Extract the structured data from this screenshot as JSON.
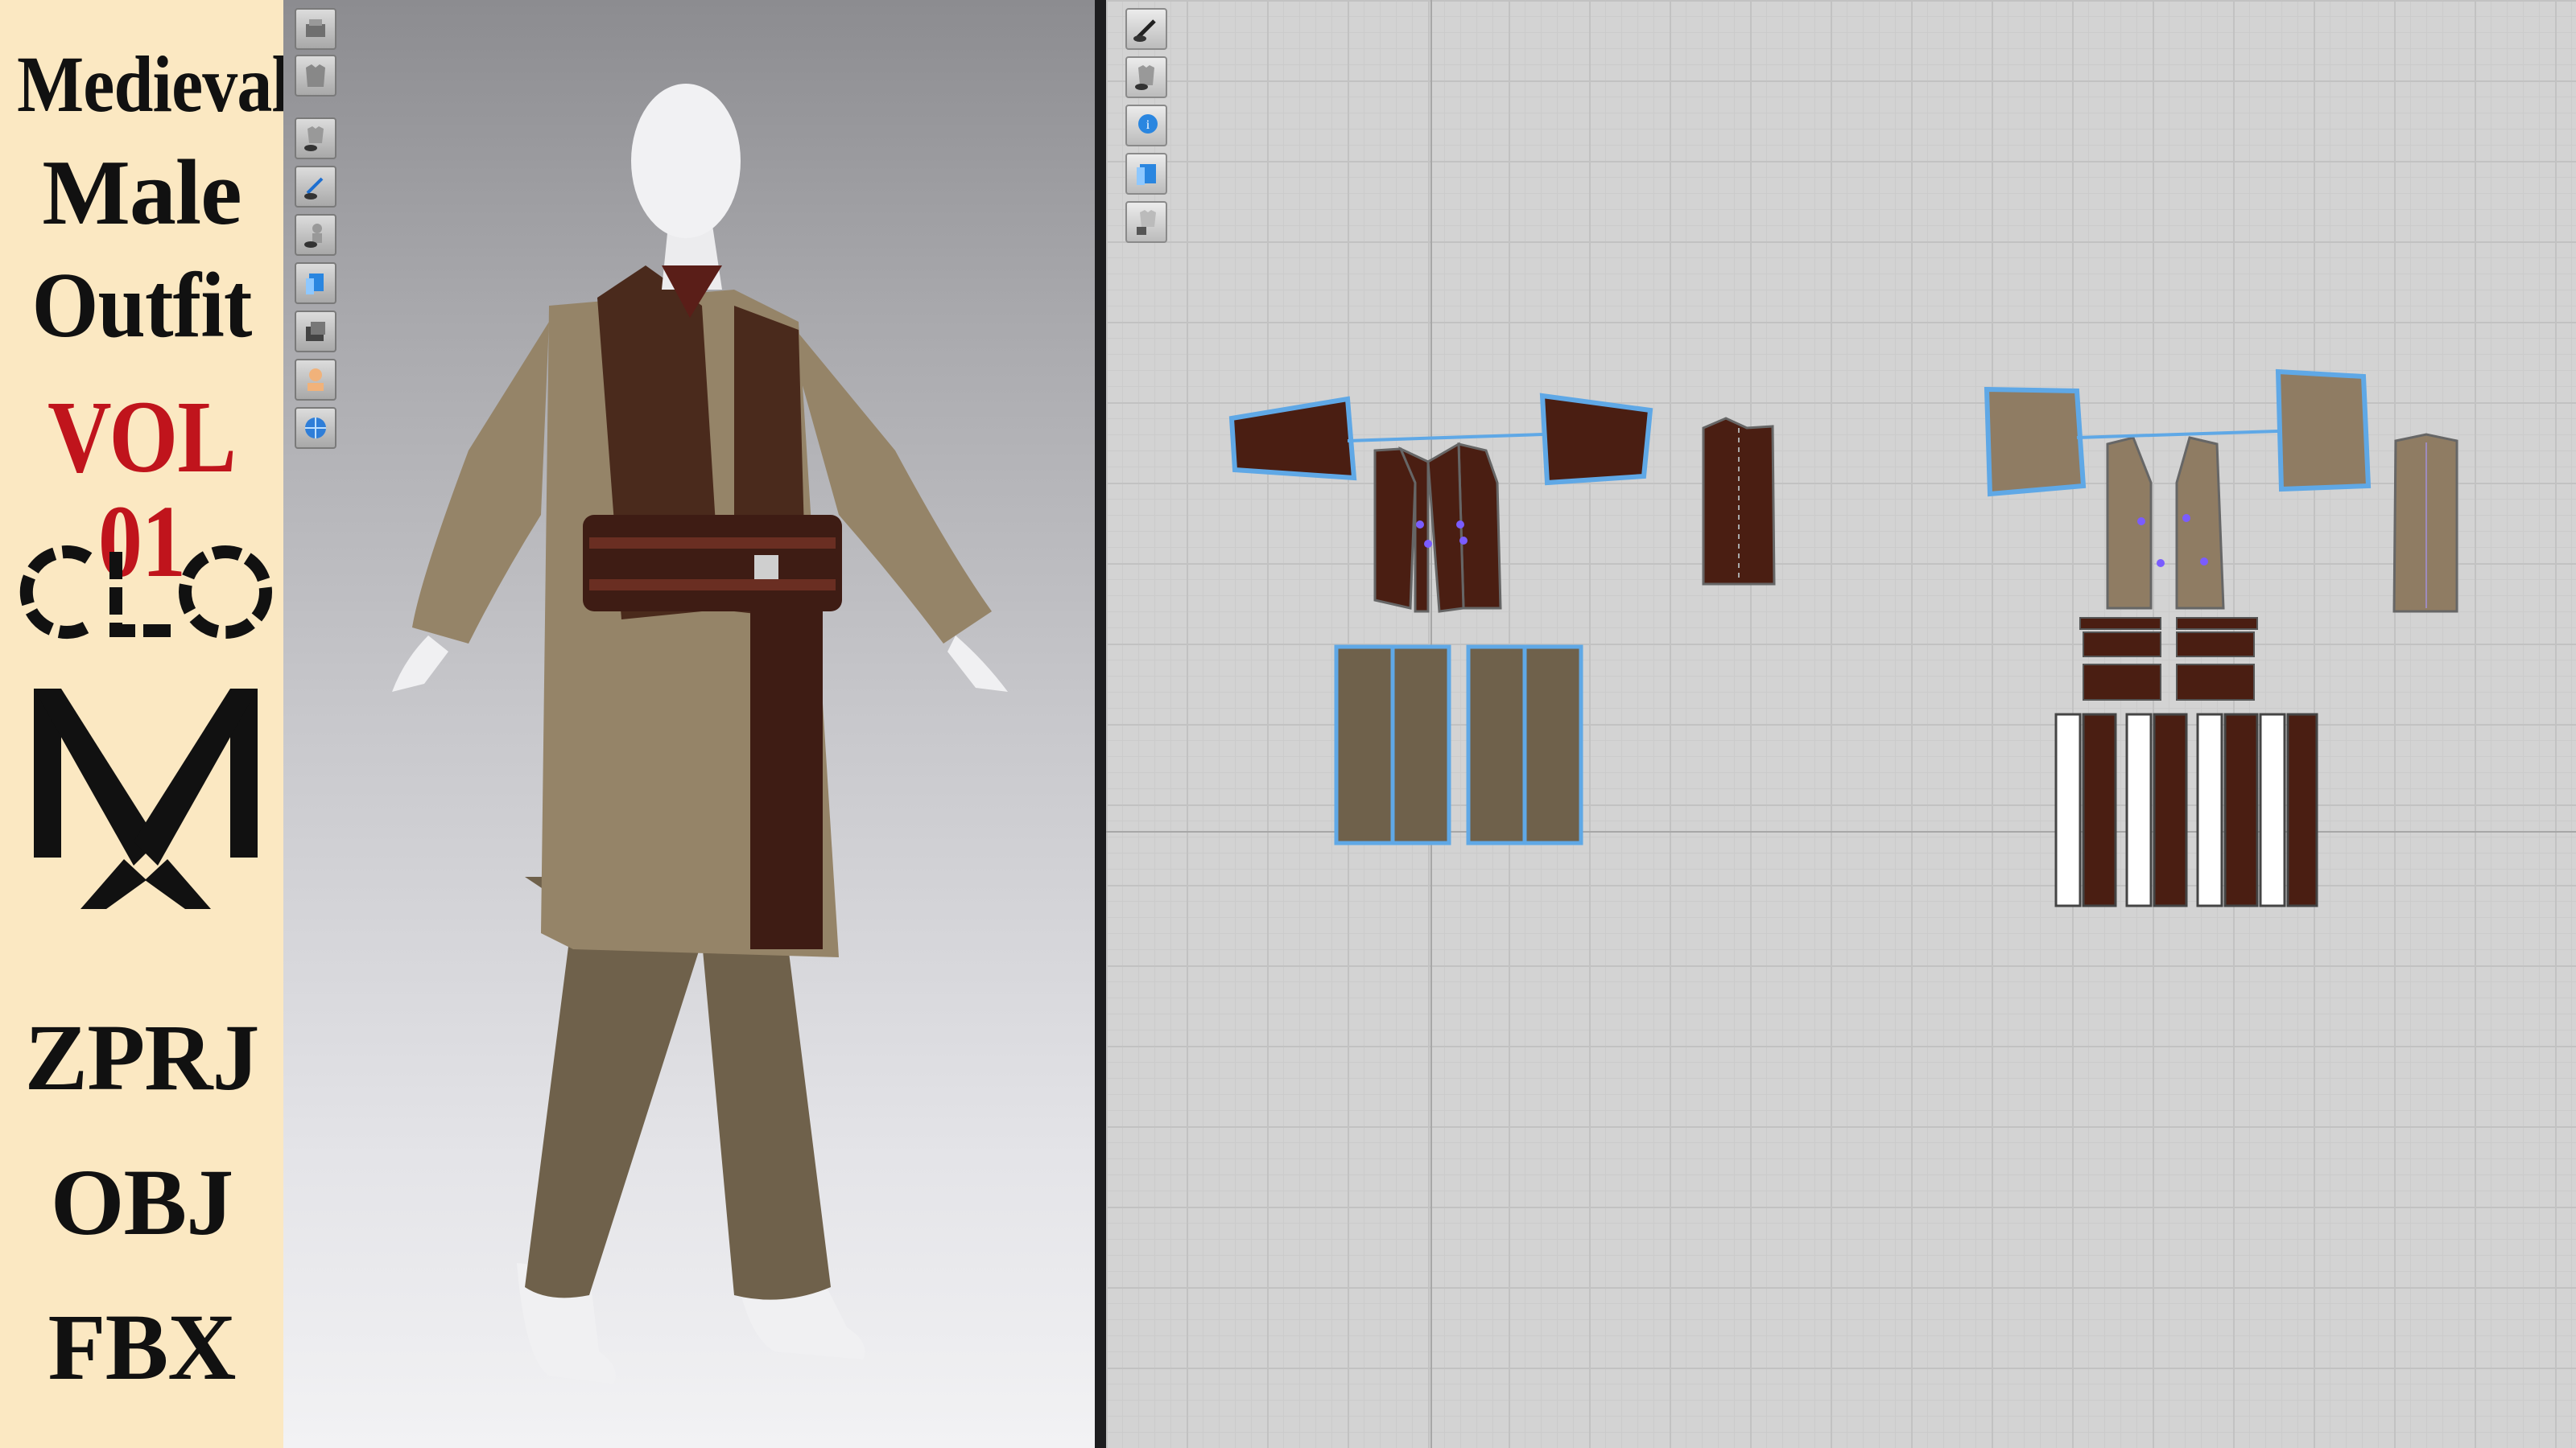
{
  "banner": {
    "title_line1": "Medieval",
    "title_line2": "Male",
    "title_line3": "Outfit",
    "volume": "VOL 01",
    "software_logo": "CLO",
    "brand_logo": "M",
    "formats": [
      "ZPRJ",
      "OBJ",
      "FBX"
    ]
  },
  "viewport3d": {
    "toolbar": [
      {
        "icon": "texture-icon"
      },
      {
        "icon": "garment-icon"
      },
      {
        "icon": "show-garment-icon"
      },
      {
        "icon": "show-pattern-icon"
      },
      {
        "icon": "show-avatar-icon"
      },
      {
        "icon": "uv-editor-icon"
      },
      {
        "icon": "render-mode-icon"
      },
      {
        "icon": "avatar-skin-icon"
      },
      {
        "icon": "world-icon"
      }
    ]
  },
  "pattern2d": {
    "toolbar": [
      {
        "icon": "edit-pattern-icon"
      },
      {
        "icon": "garment-icon"
      },
      {
        "icon": "info-icon"
      },
      {
        "icon": "fabric-icon"
      },
      {
        "icon": "lock-garment-icon"
      }
    ]
  },
  "colors": {
    "banner_bg": "#fbe8c2",
    "volume_red": "#c0141c",
    "dark_fabric": "#4a1e12",
    "light_fabric": "#8f7c63",
    "seam_blue": "#5fa8e6"
  }
}
